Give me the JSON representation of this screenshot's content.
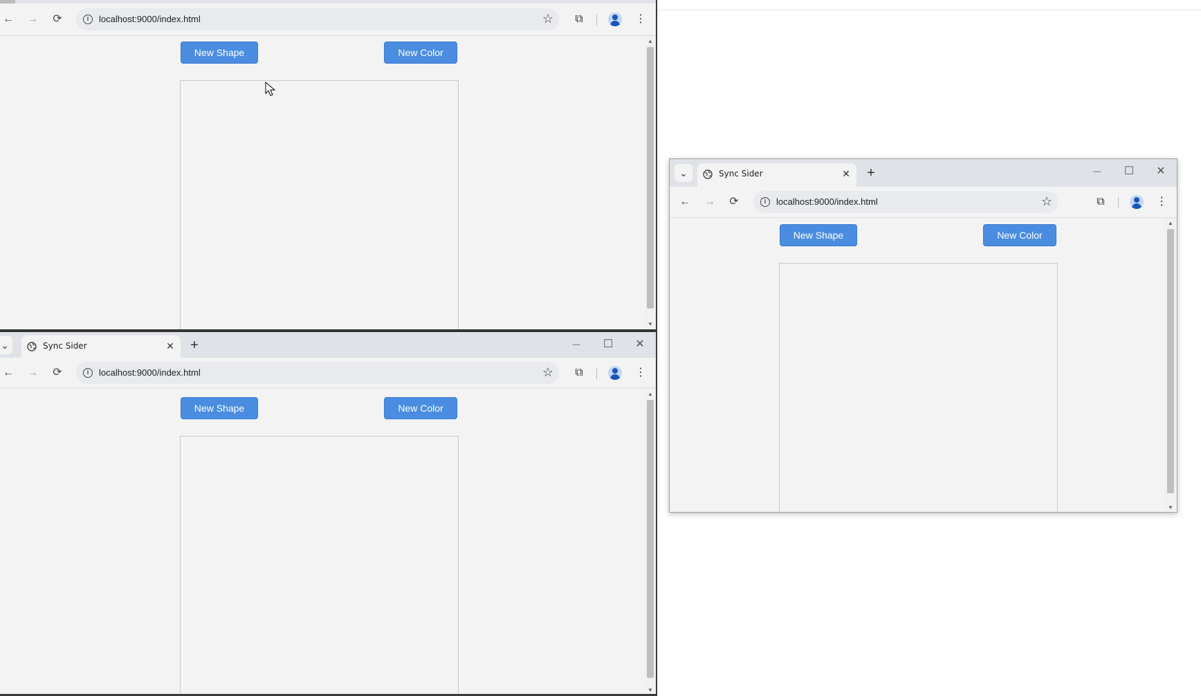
{
  "background_windows": {
    "top_left": {
      "url": "localhost:9000/index.html",
      "buttons": {
        "new_shape": "New Shape",
        "new_color": "New Color"
      }
    },
    "bottom_left": {
      "tab_title": "Sync Sider",
      "url": "localhost:9000/index.html",
      "buttons": {
        "new_shape": "New Shape",
        "new_color": "New Color"
      }
    },
    "right": {
      "tab_title": "Sync Sider",
      "url": "localhost:9000/index.html",
      "buttons": {
        "new_shape": "New Shape",
        "new_color": "New Color"
      }
    }
  },
  "glyphs": {
    "back": "←",
    "forward": "→",
    "reload": "⟳",
    "star": "☆",
    "extensions": "⧉",
    "menu": "⋮",
    "chevron_down": "⌄",
    "close": "✕",
    "plus": "+",
    "minimize": "—",
    "maximize": "☐",
    "info": "i",
    "scroll_up": "▲",
    "scroll_down": "▼"
  },
  "colors": {
    "button_bg": "#4a8de0",
    "page_bg": "#f3f3f3",
    "tabstrip_bg": "#dfe3e8",
    "avatar_accent": "#1a56b8"
  }
}
